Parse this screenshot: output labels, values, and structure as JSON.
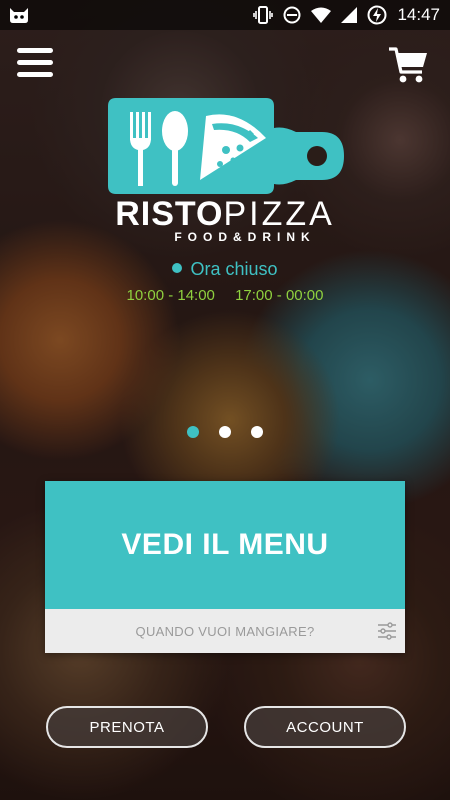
{
  "status_bar": {
    "time": "14:47",
    "icons": [
      "cat-icon",
      "vibrate-icon",
      "ban-icon",
      "wifi-icon",
      "signal-icon",
      "battery-charging-icon"
    ]
  },
  "header": {
    "menu_icon": "hamburger-menu-icon",
    "cart_icon": "shopping-cart-icon"
  },
  "brand": {
    "name_bold": "RISTO",
    "name_light": "PIZZA",
    "tagline": "FOOD&DRINK"
  },
  "status": {
    "text": "Ora chiuso",
    "dot_color": "#3fc1c3"
  },
  "hours": [
    "10:00 - 14:00",
    "17:00 - 00:00"
  ],
  "carousel": {
    "count": 3,
    "active_index": 0
  },
  "menu_card": {
    "title": "VEDI IL MENU",
    "when_placeholder": "QUANDO VUOI MANGIARE?",
    "filter_icon": "sliders-icon"
  },
  "buttons": {
    "prenota": "PRENOTA",
    "account": "ACCOUNT"
  },
  "colors": {
    "accent": "#3fc1c3",
    "hours": "#8fd13f"
  }
}
